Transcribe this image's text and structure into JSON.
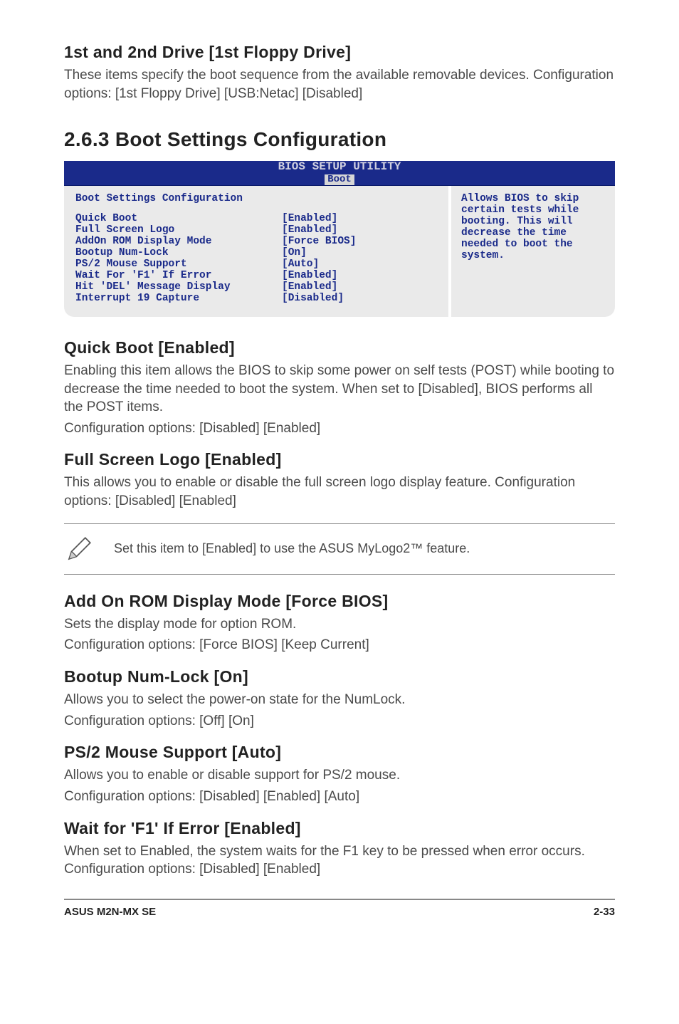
{
  "drive_section": {
    "heading": "1st and 2nd Drive [1st Floppy Drive]",
    "body": "These items specify the boot sequence from the available removable devices. Configuration options: [1st Floppy Drive] [USB:Netac] [Disabled]"
  },
  "main_heading": "2.6.3   Boot Settings Configuration",
  "bios": {
    "title_line1": "BIOS SETUP UTILITY",
    "title_line2": "Boot",
    "panel_title": "Boot Settings Configuration",
    "rows": [
      {
        "label": "Quick Boot",
        "value": "[Enabled]"
      },
      {
        "label": "Full Screen Logo",
        "value": "[Enabled]"
      },
      {
        "label": "AddOn ROM Display Mode",
        "value": "[Force BIOS]"
      },
      {
        "label": "Bootup Num-Lock",
        "value": "[On]"
      },
      {
        "label": "PS/2 Mouse Support",
        "value": "[Auto]"
      },
      {
        "label": "Wait For 'F1' If Error",
        "value": "[Enabled]"
      },
      {
        "label": "Hit 'DEL' Message Display",
        "value": "[Enabled]"
      },
      {
        "label": "Interrupt 19 Capture",
        "value": "[Disabled]"
      }
    ],
    "help": "Allows BIOS to skip certain tests while booting. This will decrease the time needed to boot the system."
  },
  "sections": {
    "quick_boot": {
      "heading": "Quick Boot [Enabled]",
      "body1": "Enabling this item allows the BIOS to skip some power on self tests (POST) while booting to decrease the time needed to boot the system. When set to [Disabled], BIOS performs all the POST items.",
      "body2": "Configuration options: [Disabled] [Enabled]"
    },
    "full_screen": {
      "heading": "Full Screen Logo [Enabled]",
      "body1": "This allows you to enable or disable the full screen logo display feature. Configuration options: [Disabled] [Enabled]"
    },
    "note": "Set this item to [Enabled] to use the ASUS MyLogo2™ feature.",
    "add_on_rom": {
      "heading": "Add On ROM Display Mode [Force BIOS]",
      "body1": "Sets the display mode for option ROM.",
      "body2": "Configuration options: [Force BIOS] [Keep Current]"
    },
    "bootup_numlock": {
      "heading": "Bootup Num-Lock [On]",
      "body1": "Allows you to select the power-on state for the NumLock.",
      "body2": "Configuration options: [Off] [On]"
    },
    "ps2_mouse": {
      "heading": "PS/2 Mouse Support [Auto]",
      "body1": "Allows you to enable or disable support for PS/2 mouse.",
      "body2": "Configuration options: [Disabled] [Enabled] [Auto]"
    },
    "wait_f1": {
      "heading": "Wait for 'F1' If Error [Enabled]",
      "body1": "When set to Enabled, the system waits for the F1 key to be pressed when error occurs. Configuration options: [Disabled] [Enabled]"
    }
  },
  "footer": {
    "left": "ASUS M2N-MX SE",
    "right": "2-33"
  }
}
